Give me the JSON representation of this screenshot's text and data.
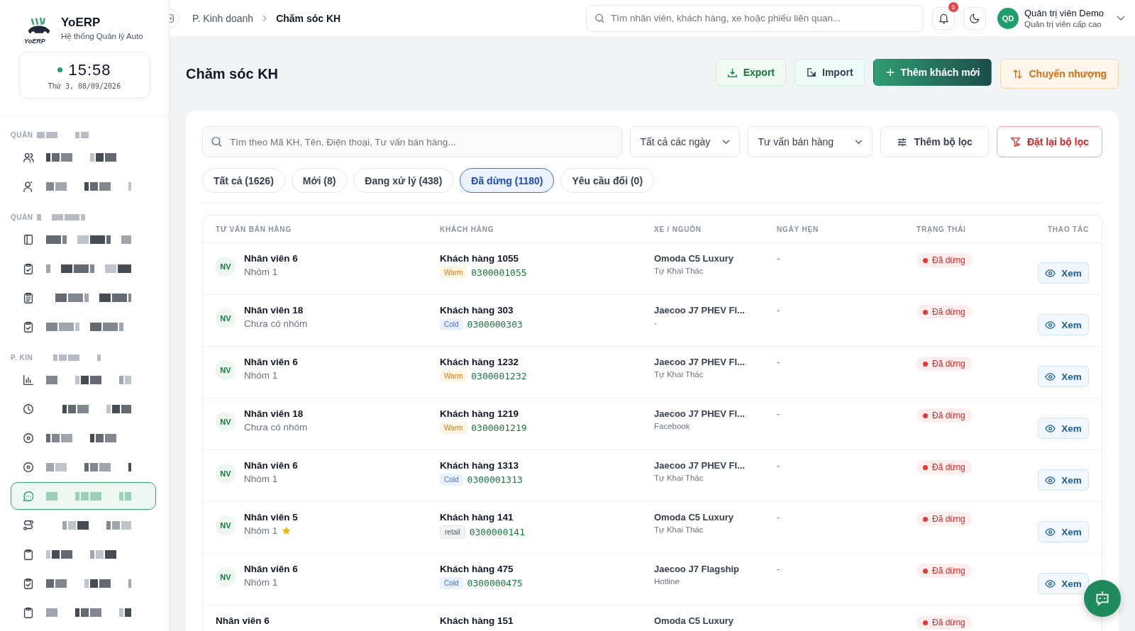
{
  "brand": {
    "name": "YoERP",
    "tagline": "Hệ thống Quản lý Auto",
    "logo_text": "YoERP"
  },
  "clock": {
    "time": "15:58",
    "date": "Thứ 3, 08/09/2026"
  },
  "sidebar": {
    "sections": [
      {
        "label": "QUẢN",
        "items": [
          {
            "kind": "users",
            "selected": false
          },
          {
            "kind": "user",
            "selected": false
          }
        ]
      },
      {
        "label": "QUẢN",
        "items": [
          {
            "kind": "columns",
            "selected": false
          },
          {
            "kind": "checklist",
            "selected": false
          },
          {
            "kind": "list",
            "selected": false
          },
          {
            "kind": "checklist",
            "selected": false
          }
        ]
      },
      {
        "label": "P. KIN",
        "items": [
          {
            "kind": "chart",
            "selected": false
          },
          {
            "kind": "clock",
            "selected": false
          },
          {
            "kind": "disc",
            "selected": false
          },
          {
            "kind": "disc",
            "selected": false
          },
          {
            "kind": "chat",
            "selected": true
          },
          {
            "kind": "route",
            "selected": false
          },
          {
            "kind": "clipboard",
            "selected": false
          },
          {
            "kind": "checklist",
            "selected": false
          },
          {
            "kind": "clipboard",
            "selected": false
          }
        ]
      }
    ]
  },
  "breadcrumb": [
    "P. Kinh doanh",
    "Chăm sóc KH"
  ],
  "global_search": {
    "placeholder": "Tìm nhân viên, khách hàng, xe hoặc phiếu liên quan..."
  },
  "notifications": {
    "count": "5"
  },
  "user": {
    "initials": "QD",
    "name": "Quản trị viên Demo",
    "role": "Quản trị viên cấp cao"
  },
  "page_title": "Chăm sóc KH",
  "actions": [
    {
      "label": "Export",
      "kind": "export"
    },
    {
      "label": "Import",
      "kind": "import"
    },
    {
      "label": "Thêm khách mới",
      "kind": "add"
    },
    {
      "label": "Chuyển nhượng",
      "kind": "transfer"
    }
  ],
  "filters": {
    "search_placeholder": "Tìm theo Mã KH, Tên, Điện thoại, Tư vấn bán hàng...",
    "date": "Tất cả các ngày",
    "advisor": "Tư vấn bán hàng",
    "more": "Thêm bộ lọc",
    "reset": "Đặt lại bộ lọc"
  },
  "tabs": [
    {
      "label": "Tất cả (1626)",
      "selected": false
    },
    {
      "label": "Mới (8)",
      "selected": false
    },
    {
      "label": "Đang xử lý (438)",
      "selected": false
    },
    {
      "label": "Đã dừng (1180)",
      "selected": true
    },
    {
      "label": "Yêu cầu đổi (0)",
      "selected": false
    }
  ],
  "table": {
    "columns": [
      "TƯ VẤN BÁN HÀNG",
      "KHÁCH HÀNG",
      "XE / NGUỒN",
      "NGÀY HẸN",
      "TRẠNG THÁI",
      "THAO TÁC"
    ],
    "rows": [
      {
        "avatar": "NV",
        "advisor": "Nhân viên 6",
        "group": "Nhóm 1",
        "starred": false,
        "customer": "Khách hàng 1055",
        "tag": {
          "label": "Warm",
          "kind": "warm"
        },
        "phone": "0300001055",
        "vehicle": "Omoda C5 Luxury",
        "source": "Tự Khai Thác",
        "appointment": "-",
        "status": "Đã dừng",
        "action": "Xem"
      },
      {
        "avatar": "NV",
        "advisor": "Nhân viên 18",
        "group": "Chưa có nhóm",
        "starred": false,
        "customer": "Khách hàng 303",
        "tag": {
          "label": "Cold",
          "kind": "cold"
        },
        "phone": "0300000303",
        "vehicle": "Jaecoo J7 PHEV Fl...",
        "source": "-",
        "appointment": "-",
        "status": "Đã dừng",
        "action": "Xem"
      },
      {
        "avatar": "NV",
        "advisor": "Nhân viên 6",
        "group": "Nhóm 1",
        "starred": false,
        "customer": "Khách hàng 1232",
        "tag": {
          "label": "Warm",
          "kind": "warm"
        },
        "phone": "0300001232",
        "vehicle": "Jaecoo J7 PHEV Fl...",
        "source": "Tự Khai Thác",
        "appointment": "-",
        "status": "Đã dừng",
        "action": "Xem"
      },
      {
        "avatar": "NV",
        "advisor": "Nhân viên 18",
        "group": "Chưa có nhóm",
        "starred": false,
        "customer": "Khách hàng 1219",
        "tag": {
          "label": "Warm",
          "kind": "warm"
        },
        "phone": "0300001219",
        "vehicle": "Jaecoo J7 PHEV Fl...",
        "source": "Facebook",
        "appointment": "-",
        "status": "Đã dừng",
        "action": "Xem"
      },
      {
        "avatar": "NV",
        "advisor": "Nhân viên 6",
        "group": "Nhóm 1",
        "starred": false,
        "customer": "Khách hàng 1313",
        "tag": {
          "label": "Cold",
          "kind": "cold"
        },
        "phone": "0300001313",
        "vehicle": "Jaecoo J7 PHEV Fl...",
        "source": "Tự Khai Thác",
        "appointment": "-",
        "status": "Đã dừng",
        "action": "Xem"
      },
      {
        "avatar": "NV",
        "advisor": "Nhân viên 5",
        "group": "Nhóm 1",
        "starred": true,
        "customer": "Khách hàng 141",
        "tag": {
          "label": "retail",
          "kind": "retail"
        },
        "phone": "0300000141",
        "vehicle": "Omoda C5 Luxury",
        "source": "Tự Khai Thác",
        "appointment": "-",
        "status": "Đã dừng",
        "action": "Xem"
      },
      {
        "avatar": "NV",
        "advisor": "Nhân viên 6",
        "group": "Nhóm 1",
        "starred": false,
        "customer": "Khách hàng 475",
        "tag": {
          "label": "Cold",
          "kind": "cold"
        },
        "phone": "0300000475",
        "vehicle": "Jaecoo J7 Flagship",
        "source": "Hotline",
        "appointment": "-",
        "status": "Đã dừng",
        "action": "Xem"
      },
      {
        "advisor": "Nhân viên 6",
        "customer": "Khách hàng 151",
        "vehicle": "Omoda C5 Luxury",
        "status": "Đã dừng"
      }
    ]
  }
}
